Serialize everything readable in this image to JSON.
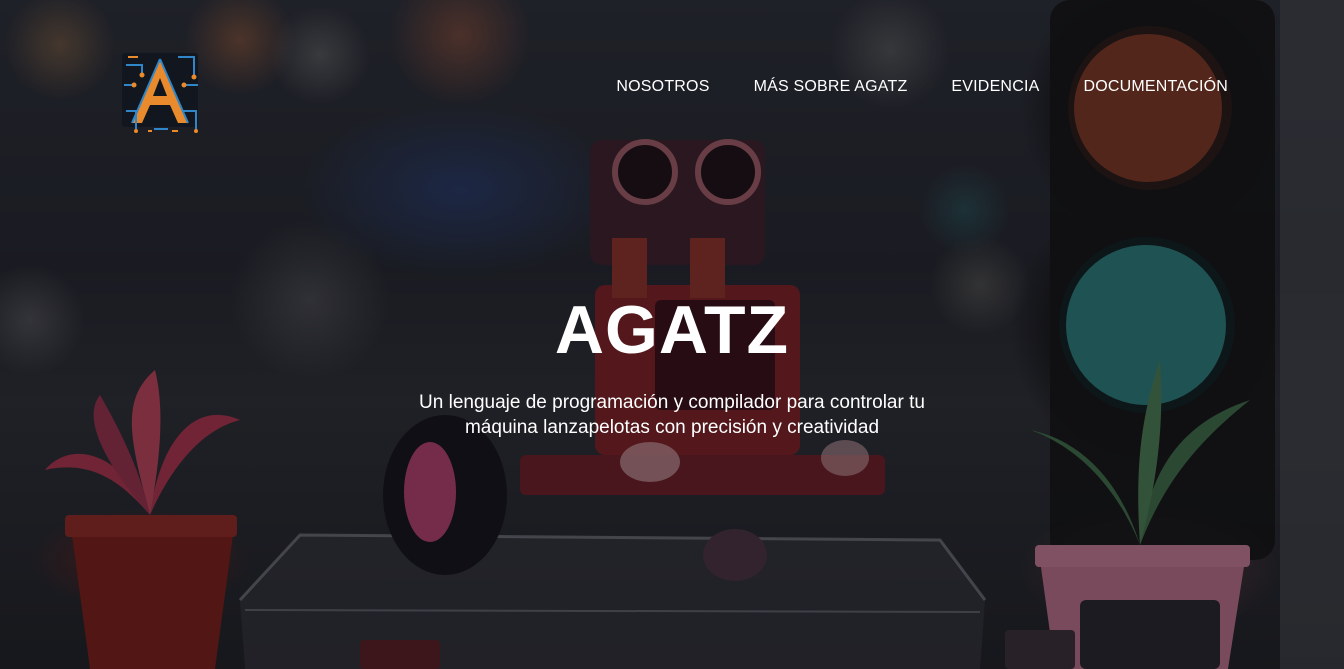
{
  "nav": {
    "logo_alt": "AGATZ",
    "links": [
      {
        "label": "NOSOTROS"
      },
      {
        "label": "MÁS SOBRE AGATZ"
      },
      {
        "label": "EVIDENCIA"
      },
      {
        "label": "DOCUMENTACIÓN"
      }
    ]
  },
  "hero": {
    "title": "AGATZ",
    "subtitle": "Un lenguaje de programación y compilador para controlar tu máquina lanzapelotas con precisión y creatividad"
  },
  "colors": {
    "text": "#ffffff",
    "logo_orange": "#e98a2c",
    "logo_blue": "#2f86c9",
    "traffic_red": "#783723",
    "traffic_teal": "#28787a"
  }
}
